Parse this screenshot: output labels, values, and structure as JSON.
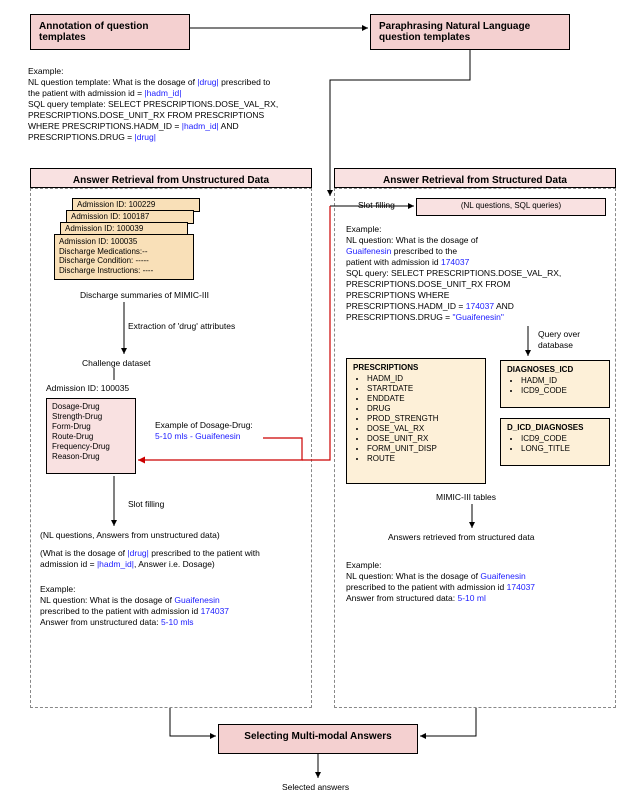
{
  "top": {
    "annot": "Annotation of question templates",
    "para": "Paraphrasing Natural Language question templates"
  },
  "topExample": {
    "l1": "Example:",
    "l2a": "NL question template: What is the dosage of ",
    "l2b": "|drug|",
    "l2c": " prescribed to",
    "l3a": "the patient with admission id = ",
    "l3b": "|hadm_id|",
    "l4": "SQL query template: SELECT PRESCRIPTIONS.DOSE_VAL_RX,",
    "l5": "PRESCRIPTIONS.DOSE_UNIT_RX FROM PRESCRIPTIONS",
    "l6a": "WHERE PRESCRIPTIONS.HADM_ID = ",
    "l6b": "|hadm_id|",
    "l6c": " AND",
    "l7a": "PRESCRIPTIONS.DRUG = ",
    "l7b": "|drug|"
  },
  "leftPanel": {
    "title": "Answer Retrieval from Unstructured Data",
    "adm1": "Admission ID: 100229",
    "adm2": "Admission ID: 100187",
    "adm3": "Admission ID: 100039",
    "adm4": "Admission ID: 100035",
    "adm4a": "Discharge Medications:--",
    "adm4b": "Discharge Condition: -----",
    "adm4c": "Discharge Instructions: ----",
    "sumLabel": "Discharge summaries of MIMIC-III",
    "extractLabel": "Extraction of 'drug' attributes",
    "challenge": "Challenge dataset",
    "chAdm": "Admission ID: 100035",
    "chList": [
      "Dosage-Drug",
      "Strength-Drug",
      "Form-Drug",
      "Route-Drug",
      "Frequency-Drug",
      "Reason-Drug"
    ],
    "exDos1": "Example of Dosage-Drug:",
    "exDos2": "5-10 mls - Guaifenesin",
    "slotLbl": "Slot filling",
    "tuple": "(NL questions, Answers from unstructured data)",
    "tuple2a": "(What is the dosage of ",
    "tuple2b": "|drug|",
    "tuple2c": " prescribed to the patient with",
    "tuple3a": "admission id = ",
    "tuple3b": "|hadm_id|",
    "tuple3c": ",  Answer i.e. Dosage)",
    "ex1": "Example:",
    "ex2a": "NL question: What is the dosage of ",
    "ex2b": "Guaifenesin",
    "ex3a": "prescribed to the patient with admission id ",
    "ex3b": "174037",
    "ex4a": "Answer from unstructured data: ",
    "ex4b": "5-10 mls"
  },
  "rightPanel": {
    "title": "Answer Retrieval from Structured Data",
    "slotLbl": "Slot-filling",
    "tuple": "(NL questions, SQL queries)",
    "ex1": "Example:",
    "ex2": "NL question: What is the dosage of",
    "ex2b": "Guaifenesin",
    "ex2c": " prescribed to the",
    "ex3a": "patient with admission id ",
    "ex3b": "174037",
    "ex4": "SQL query: SELECT PRESCRIPTIONS.DOSE_VAL_RX,",
    "ex5": "PRESCRIPTIONS.DOSE_UNIT_RX FROM",
    "ex6": "PRESCRIPTIONS WHERE",
    "ex7a": "PRESCRIPTIONS.HADM_ID = ",
    "ex7b": "174037",
    "ex7c": " AND",
    "ex8a": "PRESCRIPTIONS.DRUG = ",
    "ex8b": "\"Guaifenesin\"",
    "queryLbl": "Query over database",
    "presTitle": "PRESCRIPTIONS",
    "presList": [
      "HADM_ID",
      "STARTDATE",
      "ENDDATE",
      "DRUG",
      "PROD_STRENGTH",
      "DOSE_VAL_RX",
      "DOSE_UNIT_RX",
      "FORM_UNIT_DISP",
      "ROUTE"
    ],
    "diagTitle": "DIAGNOSES_ICD",
    "diagList": [
      "HADM_ID",
      "ICD9_CODE"
    ],
    "dicdTitle": "D_ICD_DIAGNOSES",
    "dicdList": [
      "ICD9_CODE",
      "LONG_TITLE"
    ],
    "tablesLbl": "MIMIC-III tables",
    "ansLbl": "Answers retrieved from structured data",
    "bex1": "Example:",
    "bex2a": "NL question: What is the dosage of ",
    "bex2b": "Guaifenesin",
    "bex3a": "prescribed to the patient with admission id ",
    "bex3b": "174037",
    "bex4a": "Answer from structured data: ",
    "bex4b": "5-10 ml"
  },
  "bottom": {
    "sel": "Selecting Multi-modal Answers",
    "final": "Selected answers"
  }
}
